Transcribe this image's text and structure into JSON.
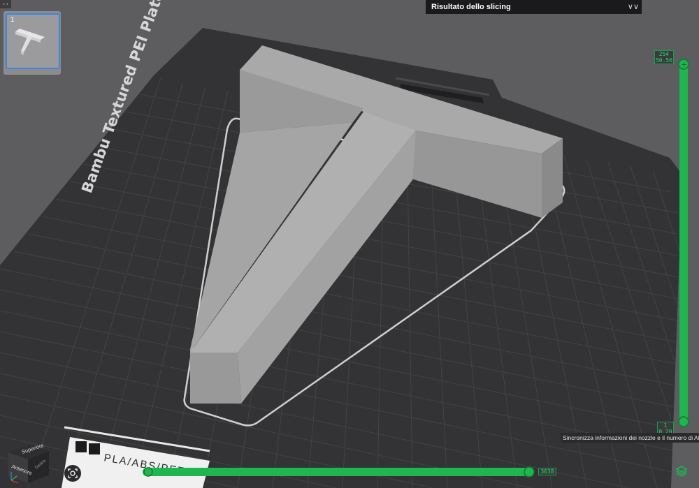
{
  "app": {
    "collapse_glyph": "‹›"
  },
  "plate_thumbnail": {
    "number": "1"
  },
  "slicing_panel": {
    "title": "Risultato dello slicing",
    "collapse_icon": "double-chevron-down-icon"
  },
  "bed": {
    "name": "Bambu Textured PEI Plate",
    "plate_label": "PLA/ABS/PETG"
  },
  "model": {
    "name": "T-shape"
  },
  "layer_slider": {
    "top_layer": "254",
    "top_height": "50.56",
    "bottom_layer": "1",
    "bottom_height": "0.20"
  },
  "move_slider": {
    "value": "3638",
    "progress": 1.0
  },
  "tooltip": {
    "text": "Sincronizza informazioni dei nozzle e il numero di AMS"
  },
  "view_cube": {
    "top_face": "Superiore",
    "front_face": "Anteriore",
    "side_face": "Destra"
  },
  "colors": {
    "accent": "#1fb54f",
    "background": "#5d5d60",
    "bed": "#333335",
    "model": "#a8a8a8",
    "selection": "#3a86e0"
  }
}
